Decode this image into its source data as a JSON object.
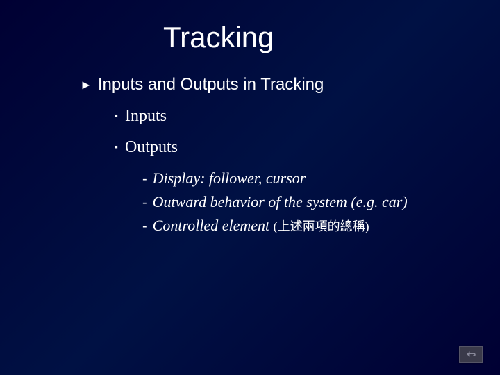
{
  "title": "Tracking",
  "level1": {
    "bullet": "►",
    "text": "Inputs and Outputs in Tracking"
  },
  "level2": [
    {
      "bullet": "▪",
      "text": "Inputs"
    },
    {
      "bullet": "▪",
      "text": "Outputs"
    }
  ],
  "level3": [
    {
      "bullet": "-",
      "text": "Display: follower, cursor"
    },
    {
      "bullet": "-",
      "text": "Outward behavior of the system (e.g. car)"
    },
    {
      "bullet": "-",
      "text": "Controlled element ",
      "cjk": "(上述兩項的總稱)"
    }
  ],
  "returnIcon": "return"
}
